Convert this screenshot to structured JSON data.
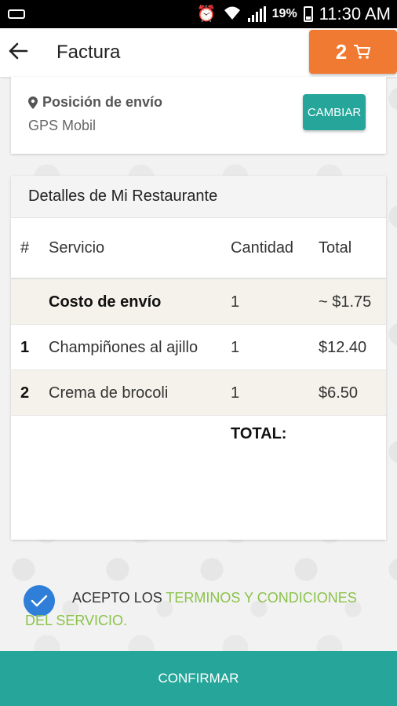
{
  "status_bar": {
    "battery_percent": "19%",
    "time": "11:30 AM"
  },
  "app_bar": {
    "title": "Factura",
    "cart_count": "2"
  },
  "location": {
    "title": "Posición de envío",
    "value": "GPS Mobil",
    "change_label": "CAMBIAR"
  },
  "detail": {
    "header": "Detalles de Mi Restaurante",
    "columns": [
      "#",
      "Servicio",
      "Cantidad",
      "Total"
    ],
    "rows": [
      {
        "num": "",
        "service": "Costo de envío",
        "qty": "1",
        "total": "~ $1.75"
      },
      {
        "num": "1",
        "service": "Champiñones al ajillo",
        "qty": "1",
        "total": "$12.40"
      },
      {
        "num": "2",
        "service": "Crema de brocoli",
        "qty": "1",
        "total": "$6.50"
      }
    ],
    "total_label": "TOTAL:"
  },
  "terms": {
    "prefix": "ACEPTO LOS ",
    "link": "TERMINOS Y CONDICIONES DEL SERVICIO."
  },
  "confirm_label": "CONFIRMAR",
  "colors": {
    "accent_teal": "#26a69a",
    "cart_orange": "#f07a32",
    "check_blue": "#2f7ed8",
    "link_green": "#8bc34a"
  }
}
